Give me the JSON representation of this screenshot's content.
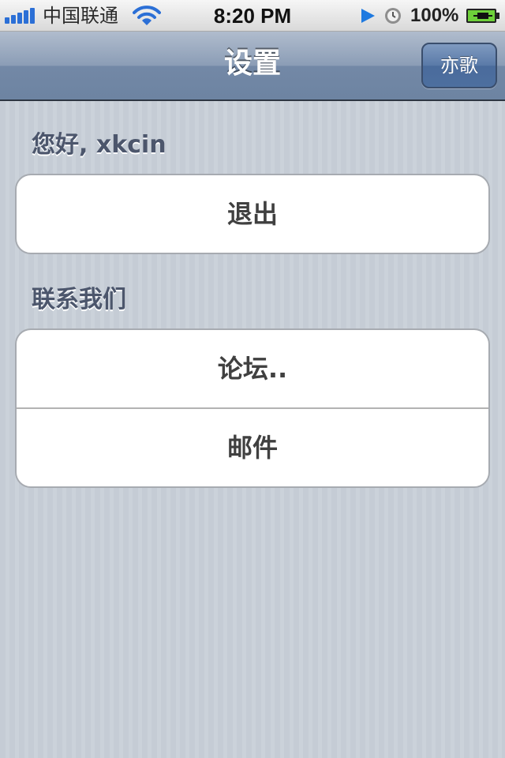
{
  "status_bar": {
    "carrier": "中国联通",
    "time": "8:20 PM",
    "battery_percent": "100%",
    "icons": [
      "signal-icon",
      "wifi-icon",
      "play-icon",
      "clock-icon",
      "battery-icon"
    ]
  },
  "nav_bar": {
    "title": "设置",
    "right_button": "亦歌"
  },
  "sections": [
    {
      "header": "您好, xkcin",
      "rows": [
        {
          "label": "退出"
        }
      ]
    },
    {
      "header": "联系我们",
      "rows": [
        {
          "label": "论坛.."
        },
        {
          "label": "邮件"
        }
      ]
    }
  ],
  "colors": {
    "nav_bar": "#6d84a2",
    "nav_button": "#4d6f9f",
    "background": "#c5ccd5",
    "section_header": "#4c566c",
    "cell_text": "#404040",
    "signal": "#2b6fd6",
    "battery_fill": "#6ed13a"
  }
}
